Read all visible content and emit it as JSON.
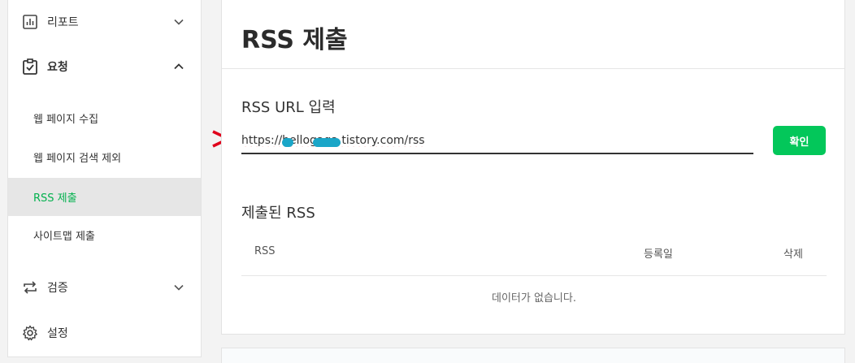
{
  "sidebar": {
    "menu": [
      {
        "label": "리포트",
        "icon": "chart-report-icon",
        "expanded": false
      },
      {
        "label": "요청",
        "icon": "clipboard-check-icon",
        "expanded": true
      },
      {
        "label": "검증",
        "icon": "repeat-arrows-icon",
        "expanded": false
      },
      {
        "label": "설정",
        "icon": "gear-icon"
      }
    ],
    "submenu": [
      {
        "label": "웹 페이지 수집"
      },
      {
        "label": "웹 페이지 검색 제외"
      },
      {
        "label": "RSS 제출",
        "active": true
      },
      {
        "label": "사이트맵 제출"
      }
    ]
  },
  "main": {
    "title": "RSS 제출",
    "input_section_label": "RSS URL 입력",
    "url_value": "https://hellogaga.tistory.com/rss",
    "confirm_label": "확인",
    "submitted_label": "제출된 RSS",
    "table": {
      "columns": [
        "RSS",
        "등록일",
        "삭제"
      ],
      "empty_message": "데이터가 없습니다."
    }
  },
  "colors": {
    "accent_green": "#03c75a",
    "active_text": "#03b14e",
    "annotation_red": "#e0001b",
    "redaction": "#1aa6c8"
  }
}
